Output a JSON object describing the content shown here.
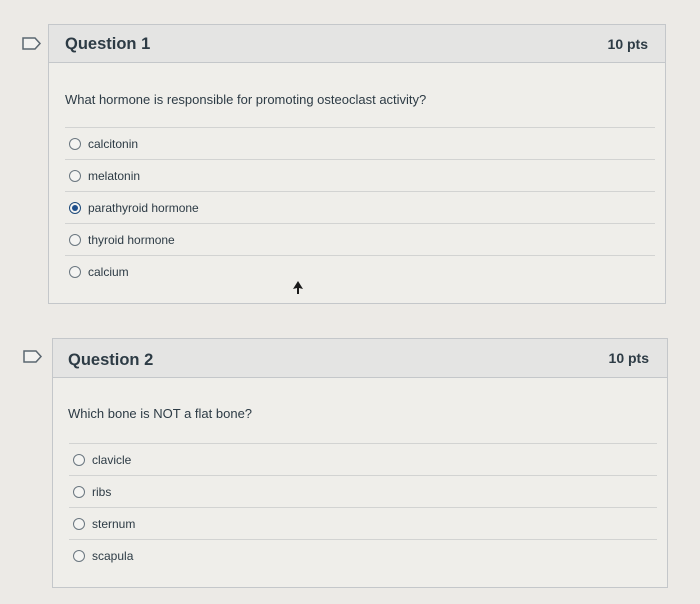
{
  "questions": [
    {
      "title": "Question 1",
      "points": "10 pts",
      "text": "What hormone is responsible for promoting osteoclast activity?",
      "answers": [
        {
          "label": "calcitonin",
          "selected": false
        },
        {
          "label": "melatonin",
          "selected": false
        },
        {
          "label": "parathyroid hormone",
          "selected": true
        },
        {
          "label": "thyroid hormone",
          "selected": false
        },
        {
          "label": "calcium",
          "selected": false
        }
      ]
    },
    {
      "title": "Question 2",
      "points": "10 pts",
      "text": "Which bone is NOT a flat bone?",
      "answers": [
        {
          "label": "clavicle",
          "selected": false
        },
        {
          "label": "ribs",
          "selected": false
        },
        {
          "label": "sternum",
          "selected": false
        },
        {
          "label": "scapula",
          "selected": false
        }
      ]
    }
  ],
  "icons": {
    "flag": "flag-bookmark-icon",
    "cursor": "mouse-pointer-icon"
  },
  "colors": {
    "selected_radio": "#1e4f8c",
    "text": "#2d3b45"
  }
}
